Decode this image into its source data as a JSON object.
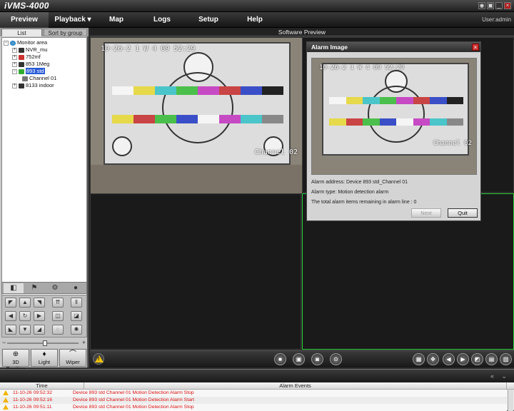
{
  "window": {
    "title": "iVMS-4000",
    "user": "User:admin"
  },
  "menu": [
    {
      "label": "Preview"
    },
    {
      "label": "Playback ▾"
    },
    {
      "label": "Map"
    },
    {
      "label": "Logs"
    },
    {
      "label": "Setup"
    },
    {
      "label": "Help"
    }
  ],
  "left_panel": {
    "tabs": [
      "List",
      "Sort by group"
    ],
    "tree": [
      {
        "label": "Monitor area"
      },
      {
        "label": "NVR_mu"
      },
      {
        "label": "752mf"
      },
      {
        "label": "853 1Meg"
      },
      {
        "label": "893 std"
      },
      {
        "label": "Channel 01"
      },
      {
        "label": "8133 indoor"
      }
    ],
    "ptz_buttons": [
      {
        "label": "3D Position"
      },
      {
        "label": "Light"
      },
      {
        "label": "Wiper"
      }
    ]
  },
  "preview": {
    "header": "Software Preview",
    "osd_time": "10-26-2  1 W 4 09 52:29",
    "osd_channel": "Channel 02"
  },
  "dialog": {
    "title": "Alarm Image",
    "osd_time": "10-26-2  1 W 4 09 52:29",
    "osd_channel": "Channel 02",
    "address": "Alarm address: Device 893 std_Channel 01",
    "type": "Alarm type: Motion detection alarm",
    "remaining": "The total alarm items remaining in alarm line : 0",
    "next_label": "Next",
    "quit_label": "Quit"
  },
  "events": {
    "columns": [
      "Time",
      "Alarm Events"
    ],
    "rows": [
      {
        "time": "11-10-26 09:52:32",
        "desc": "Device 893 std Channel 01 Motion Detection Alarm Stop"
      },
      {
        "time": "11-10-26 09:52:16",
        "desc": "Device 893 std Channel 01 Motion Detection Alarm Start"
      },
      {
        "time": "11-10-26 09:51:11",
        "desc": "Device 893 std Channel 01 Motion Detection Alarm Stop"
      }
    ]
  },
  "colors": {
    "selection": "#2a5bd7",
    "active_pane": "#2ad33a",
    "alarm_text": "#dd1111"
  }
}
